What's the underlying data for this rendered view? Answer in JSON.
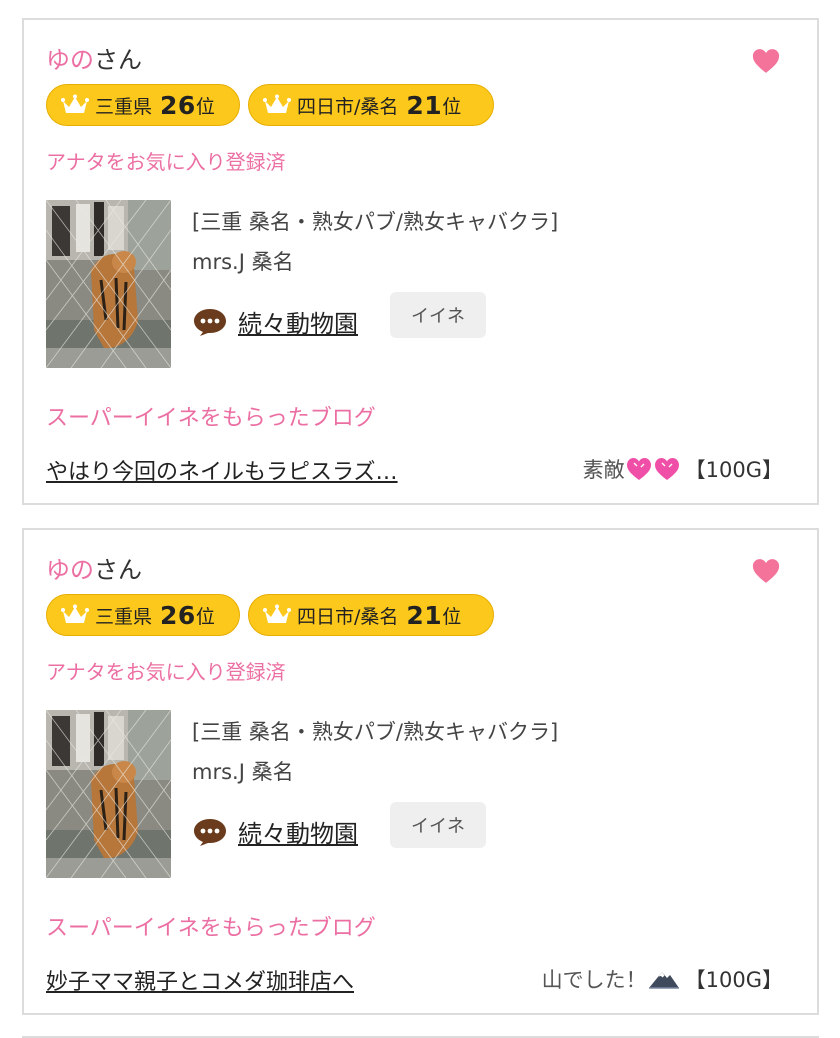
{
  "cards": [
    {
      "user": {
        "name": "ゆの",
        "suffix": "さん"
      },
      "rank_badges": [
        {
          "area": "三重県",
          "rank": "26",
          "suffix": "位"
        },
        {
          "area": "四日市/桑名",
          "rank": "21",
          "suffix": "位"
        }
      ],
      "favorite_status": "アナタをお気に入り登録済",
      "shop": {
        "category": "[三重 桑名・熟女パブ/熟女キャバクラ]",
        "name": "mrs.J 桑名"
      },
      "blog": {
        "title": "続々動物園",
        "like_label": "イイネ"
      },
      "super_label": "スーパーイイネをもらったブログ",
      "post": {
        "title": "やはり今回のネイルもラピスラズ…",
        "comment": "素敵",
        "comment_icons": [
          "pink-hearts-icon"
        ],
        "gift": "【100G】"
      }
    },
    {
      "user": {
        "name": "ゆの",
        "suffix": "さん"
      },
      "rank_badges": [
        {
          "area": "三重県",
          "rank": "26",
          "suffix": "位"
        },
        {
          "area": "四日市/桑名",
          "rank": "21",
          "suffix": "位"
        }
      ],
      "favorite_status": "アナタをお気に入り登録済",
      "shop": {
        "category": "[三重 桑名・熟女パブ/熟女キャバクラ]",
        "name": "mrs.J 桑名"
      },
      "blog": {
        "title": "続々動物園",
        "like_label": "イイネ"
      },
      "super_label": "スーパーイイネをもらったブログ",
      "post": {
        "title": "妙子ママ親子とコメダ珈琲店へ",
        "comment": "山でした！",
        "comment_icons": [
          "mountain-icon"
        ],
        "gift": "【100G】"
      }
    }
  ],
  "colors": {
    "accent_pink": "#ec6fa3",
    "badge_yellow": "#fcc81c",
    "heart": "#f3739a"
  }
}
